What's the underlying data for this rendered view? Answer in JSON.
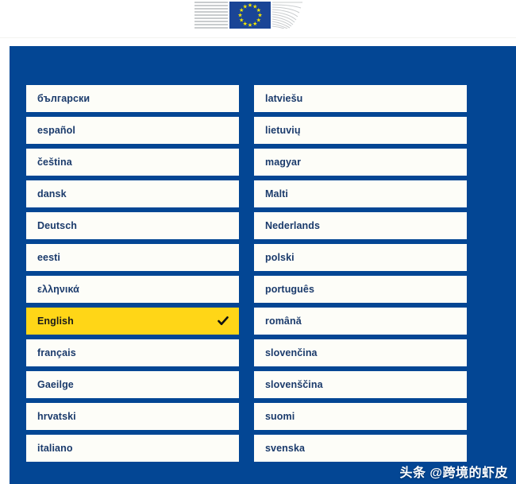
{
  "header": {
    "logo_name": "european-commission-logo",
    "flag_alt": "european-union-flag",
    "stars_count": 12,
    "flag_blue": "#1a4596",
    "star_yellow": "#f5e800",
    "stripe_grey": "#c9ccce"
  },
  "panel": {
    "background_color": "#034694",
    "card_background": "#fdfdf8",
    "text_color": "#1a3a6b",
    "selected_background": "#ffd617",
    "selected_text_color": "#1a1a1a"
  },
  "languages": {
    "left_column": [
      {
        "label": "български",
        "selected": false
      },
      {
        "label": "español",
        "selected": false
      },
      {
        "label": "čeština",
        "selected": false
      },
      {
        "label": "dansk",
        "selected": false
      },
      {
        "label": "Deutsch",
        "selected": false
      },
      {
        "label": "eesti",
        "selected": false
      },
      {
        "label": "ελληνικά",
        "selected": false
      },
      {
        "label": "English",
        "selected": true
      },
      {
        "label": "français",
        "selected": false
      },
      {
        "label": "Gaeilge",
        "selected": false
      },
      {
        "label": "hrvatski",
        "selected": false
      },
      {
        "label": "italiano",
        "selected": false
      }
    ],
    "right_column": [
      {
        "label": "latviešu",
        "selected": false
      },
      {
        "label": "lietuvių",
        "selected": false
      },
      {
        "label": "magyar",
        "selected": false
      },
      {
        "label": "Malti",
        "selected": false
      },
      {
        "label": "Nederlands",
        "selected": false
      },
      {
        "label": "polski",
        "selected": false
      },
      {
        "label": "português",
        "selected": false
      },
      {
        "label": "română",
        "selected": false
      },
      {
        "label": "slovenčina",
        "selected": false
      },
      {
        "label": "slovenščina",
        "selected": false
      },
      {
        "label": "suomi",
        "selected": false
      },
      {
        "label": "svenska",
        "selected": false
      }
    ]
  },
  "selected_language": "English",
  "check_icon": "checkmark-icon",
  "watermark": {
    "text": "头条 @跨境的虾皮"
  }
}
